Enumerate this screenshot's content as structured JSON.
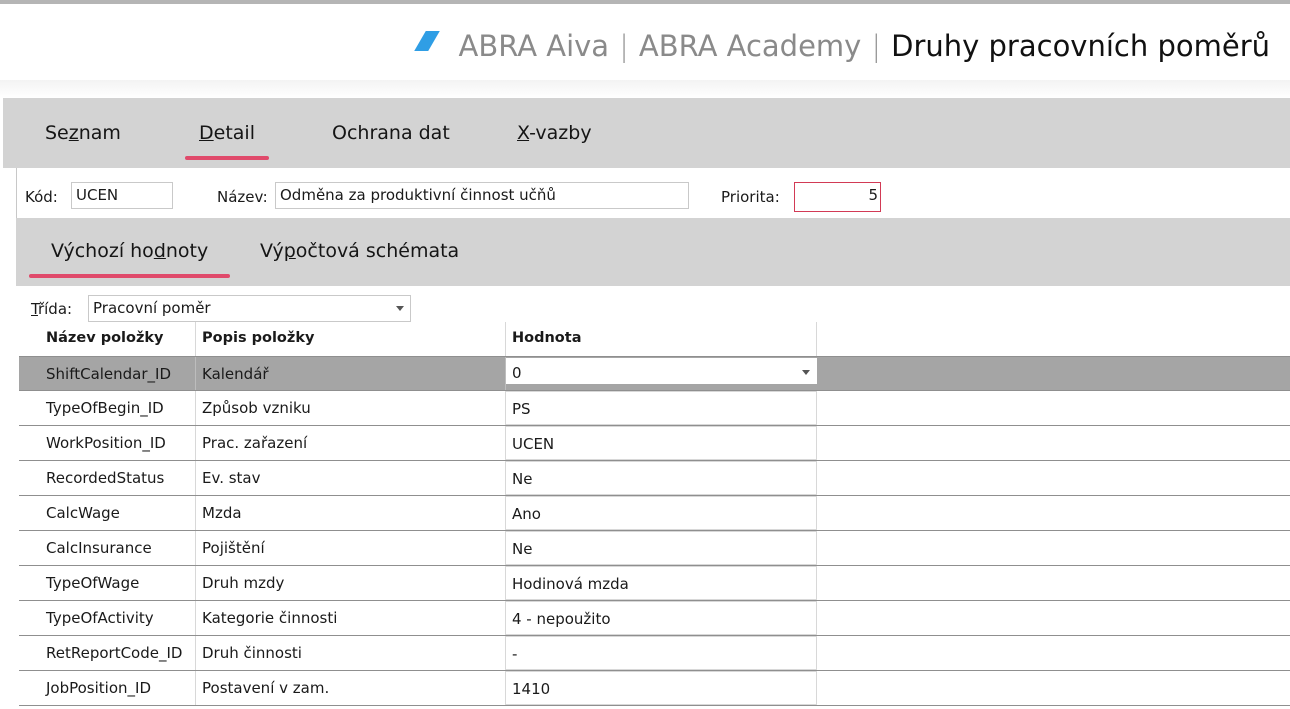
{
  "header": {
    "crumbs": [
      "ABRA Aiva",
      "ABRA Academy"
    ],
    "separator": "|",
    "current": "Druhy pracovních poměrů",
    "logo_color": "#2f9ee5"
  },
  "tabs": {
    "seznam": {
      "pre": "Se",
      "key": "z",
      "post": "nam"
    },
    "detail": {
      "pre": "",
      "key": "D",
      "post": "etail"
    },
    "ochrana": {
      "label": "Ochrana dat"
    },
    "xvazby": {
      "pre": "",
      "key": "X",
      "post": "-vazby"
    },
    "active": "detail",
    "accent_color": "#e04a6b"
  },
  "fields": {
    "kod_label": "Kód:",
    "kod_value": "UCEN",
    "nazev_label": "Název:",
    "nazev_value": "Odměna za produktivní činnost učňů",
    "priorita_label": "Priorita:",
    "priorita_value": "5"
  },
  "subtabs": {
    "vychozi": {
      "pre": "Výchozí ho",
      "key": "d",
      "post": "noty"
    },
    "vypoctova": {
      "pre": "Vý",
      "key": "p",
      "post": "očtová schémata"
    },
    "active": "vychozi"
  },
  "trida": {
    "label_key": "T",
    "label_rest": "řída:",
    "value": "Pracovní poměr"
  },
  "grid": {
    "columns": [
      "Název položky",
      "Popis položky",
      "Hodnota"
    ],
    "rows": [
      {
        "name": "ShiftCalendar_ID",
        "desc": "Kalendář",
        "value": "0",
        "selected": true
      },
      {
        "name": "TypeOfBegin_ID",
        "desc": "Způsob vzniku",
        "value": "PS"
      },
      {
        "name": "WorkPosition_ID",
        "desc": "Prac. zařazení",
        "value": "UCEN"
      },
      {
        "name": "RecordedStatus",
        "desc": "Ev. stav",
        "value": "Ne"
      },
      {
        "name": "CalcWage",
        "desc": "Mzda",
        "value": "Ano"
      },
      {
        "name": "CalcInsurance",
        "desc": "Pojištění",
        "value": "Ne"
      },
      {
        "name": "TypeOfWage",
        "desc": "Druh mzdy",
        "value": "Hodinová mzda"
      },
      {
        "name": "TypeOfActivity",
        "desc": "Kategorie činnosti",
        "value": "4 - nepoužito"
      },
      {
        "name": "RetReportCode_ID",
        "desc": "Druh činnosti",
        "value": "-"
      },
      {
        "name": "JobPosition_ID",
        "desc": "Postavení v zam.",
        "value": "1410"
      }
    ]
  }
}
